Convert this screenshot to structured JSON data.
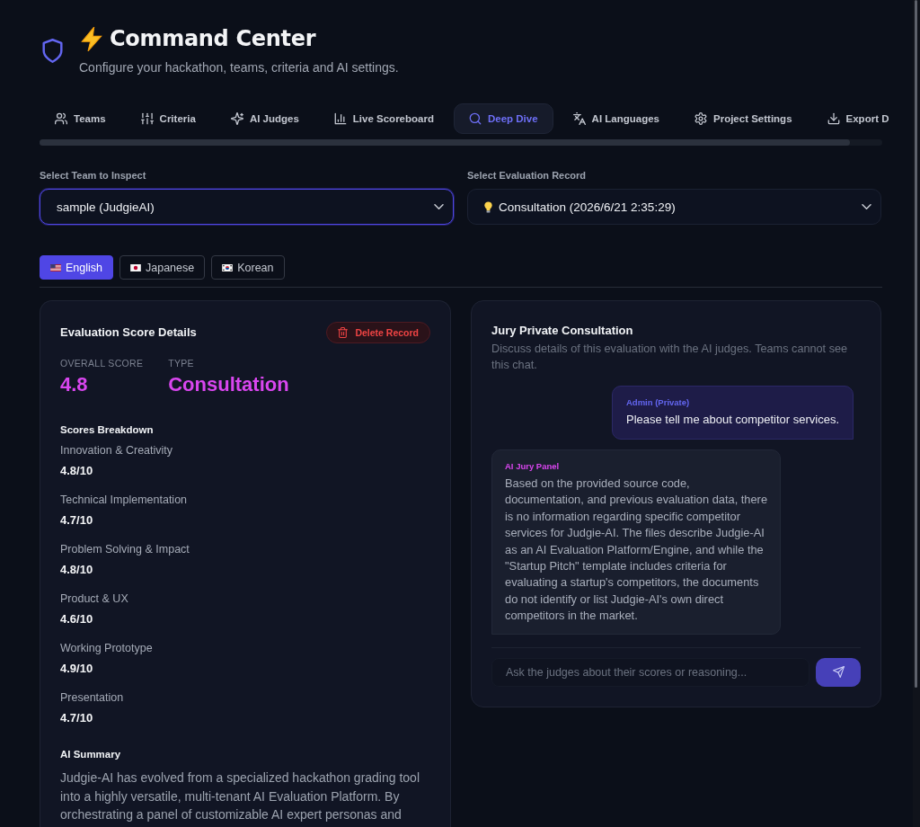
{
  "header": {
    "title": "Command Center",
    "subtitle": "Configure your hackathon, teams, criteria and AI settings."
  },
  "tabs": [
    {
      "label": "Teams",
      "selected": false
    },
    {
      "label": "Criteria",
      "selected": false
    },
    {
      "label": "AI Judges",
      "selected": false
    },
    {
      "label": "Live Scoreboard",
      "selected": false
    },
    {
      "label": "Deep Dive",
      "selected": true
    },
    {
      "label": "AI Languages",
      "selected": false
    },
    {
      "label": "Project Settings",
      "selected": false
    },
    {
      "label": "Export D",
      "selected": false
    }
  ],
  "team_select": {
    "label": "Select Team to Inspect",
    "value": "sample (JudgieAI)",
    "focused": true
  },
  "record_select": {
    "label": "Select Evaluation Record",
    "value": "Consultation (2026/6/21 2:35:29)",
    "focused": false
  },
  "languages": [
    {
      "label": "English",
      "selected": true
    },
    {
      "label": "Japanese",
      "selected": false
    },
    {
      "label": "Korean",
      "selected": false
    }
  ],
  "score_card": {
    "title": "Evaluation Score Details",
    "delete_button": "Delete Record",
    "overall_label": "OVERALL SCORE",
    "overall_score": "4.8",
    "type_label": "TYPE",
    "type_value": "Consultation",
    "breakdown_title": "Scores Breakdown",
    "scores": [
      {
        "name": "Innovation & Creativity",
        "score": "4.8/10"
      },
      {
        "name": "Technical Implementation",
        "score": "4.7/10"
      },
      {
        "name": "Problem Solving & Impact",
        "score": "4.8/10"
      },
      {
        "name": "Product & UX",
        "score": "4.6/10"
      },
      {
        "name": "Working Prototype",
        "score": "4.9/10"
      },
      {
        "name": "Presentation",
        "score": "4.7/10"
      }
    ],
    "summary_title": "AI Summary",
    "summary": "Judgie-AI has evolved from a specialized hackathon grading tool into a highly versatile, multi-tenant AI Evaluation Platform. By orchestrating a panel of customizable AI expert personas and"
  },
  "consultation": {
    "title": "Jury Private Consultation",
    "description": "Discuss details of this evaluation with the AI judges. Teams cannot see this chat.",
    "messages": [
      {
        "kind": "admin",
        "sender": "Admin (Private)",
        "text": "Please tell me about competitor services."
      },
      {
        "kind": "ai",
        "sender": "AI Jury Panel",
        "text": "Based on the provided source code, documentation, and previous evaluation data, there is no information regarding specific competitor services for Judgie-AI. The files describe Judgie-AI as an AI Evaluation Platform/Engine, and while the \"Startup Pitch\" template includes criteria for evaluating a startup's competitors, the documents do not identify or list Judgie-AI's own direct competitors in the market."
      }
    ],
    "input": {
      "placeholder": "Ask the judges about their scores or reasoning..."
    }
  }
}
